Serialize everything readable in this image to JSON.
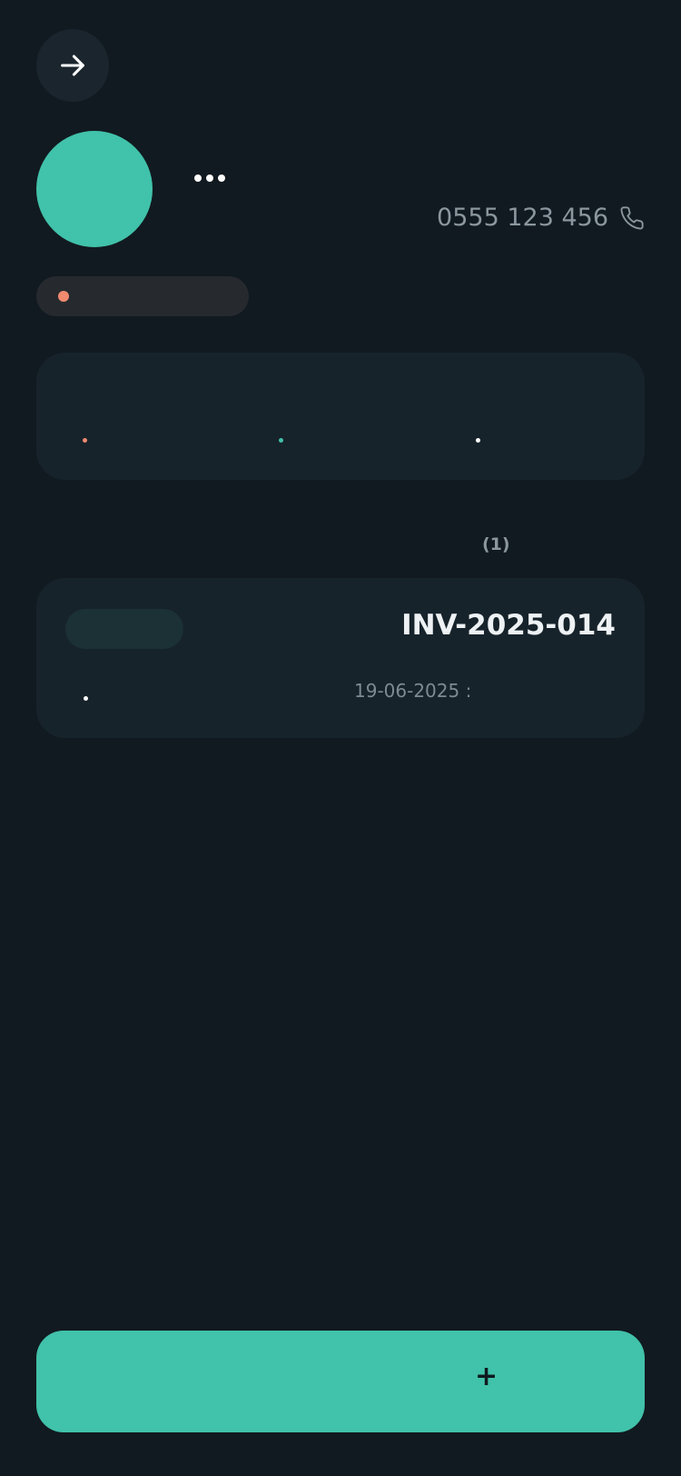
{
  "header": {
    "back_icon": "arrow-right-icon",
    "more_icon": "more-dots-icon"
  },
  "profile": {
    "avatar_color": "#41c2aa",
    "phone": "0555 123 456",
    "phone_icon": "phone-icon"
  },
  "status": {
    "dot_color": "#f28a6f"
  },
  "summary": {
    "indicators": [
      {
        "color": "#f28a6f"
      },
      {
        "color": "#41c2aa"
      },
      {
        "color": "#ffffff"
      }
    ]
  },
  "invoices": {
    "count_label": "(1)",
    "items": [
      {
        "number": "INV-2025-014",
        "date": "19-06-2025 :"
      }
    ]
  },
  "actions": {
    "add_label": "+"
  },
  "colors": {
    "background": "#111a20",
    "card": "#17232b",
    "accent": "#41c2aa",
    "warning": "#f28a6f"
  }
}
